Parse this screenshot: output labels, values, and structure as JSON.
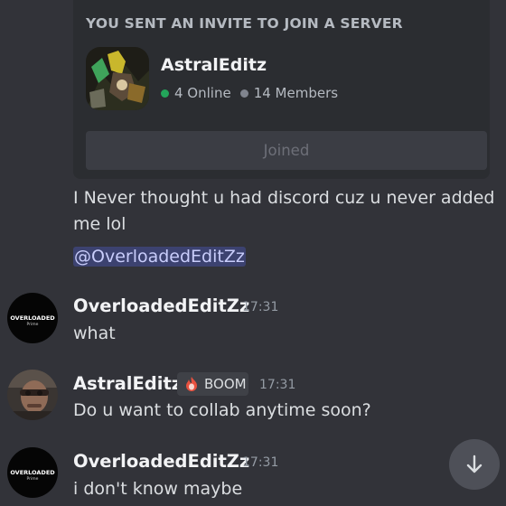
{
  "invite": {
    "heading": "YOU SENT AN INVITE TO JOIN A SERVER",
    "server_name": "AstralEditz",
    "online": "4 Online",
    "members": "14 Members",
    "button_label": "Joined"
  },
  "messages": [
    {
      "text_line1": "I Never thought u had discord cuz u never added",
      "text_line2": "me lol",
      "mention": "@OverloadedEditZz"
    },
    {
      "username": "OverloadedEditZz",
      "time": "17:31",
      "text": "what",
      "avatar_text_top": "OVERLOADED",
      "avatar_text_bottom": "Prime"
    },
    {
      "username": "AstralEditz",
      "tag": "BOOM",
      "time": "17:31",
      "text": "Do u want to collab anytime soon?"
    },
    {
      "username": "OverloadedEditZz",
      "time": "17:31",
      "text": "i don't know maybe",
      "avatar_text_top": "OVERLOADED",
      "avatar_text_bottom": "Prime"
    }
  ],
  "colors": {
    "background": "#323339",
    "online": "#23a55a",
    "mention_bg": "#3c4270",
    "mention_text": "#c9cdfb"
  },
  "icons": {
    "scroll": "arrow-down-icon",
    "tag": "fire-icon"
  }
}
